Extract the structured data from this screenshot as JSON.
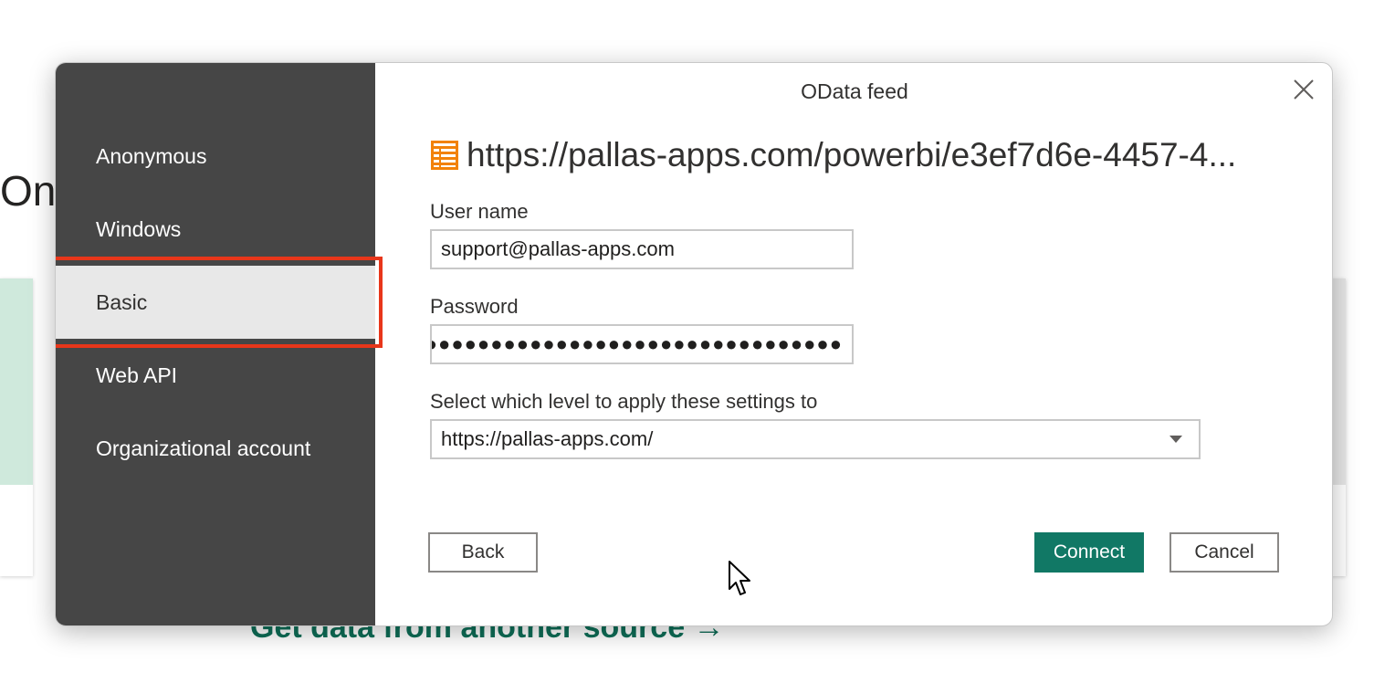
{
  "background": {
    "heading_fragment": "On",
    "get_data_link": "Get data from another source →"
  },
  "dialog": {
    "title": "OData feed",
    "close_icon": "close-icon",
    "feed_icon": "odata-feed-icon",
    "feed_url": "https://pallas-apps.com/powerbi/e3ef7d6e-4457-4..."
  },
  "sidebar": {
    "selected_index": 2,
    "items": [
      {
        "label": "Anonymous"
      },
      {
        "label": "Windows"
      },
      {
        "label": "Basic"
      },
      {
        "label": "Web API"
      },
      {
        "label": "Organizational account"
      }
    ]
  },
  "form": {
    "username_label": "User name",
    "username_value": "support@pallas-apps.com",
    "password_label": "Password",
    "password_value": "●●●●●●●●●●●●●●●●●●●●●●●●●●●●●●●●●",
    "level_label": "Select which level to apply these settings to",
    "level_value": "https://pallas-apps.com/"
  },
  "buttons": {
    "back": "Back",
    "connect": "Connect",
    "cancel": "Cancel"
  },
  "colors": {
    "sidebar_bg": "#464646",
    "selected_bg": "#e8e8e8",
    "highlight_border": "#e8361a",
    "primary": "#117865",
    "feed_icon": "#f2820a"
  }
}
